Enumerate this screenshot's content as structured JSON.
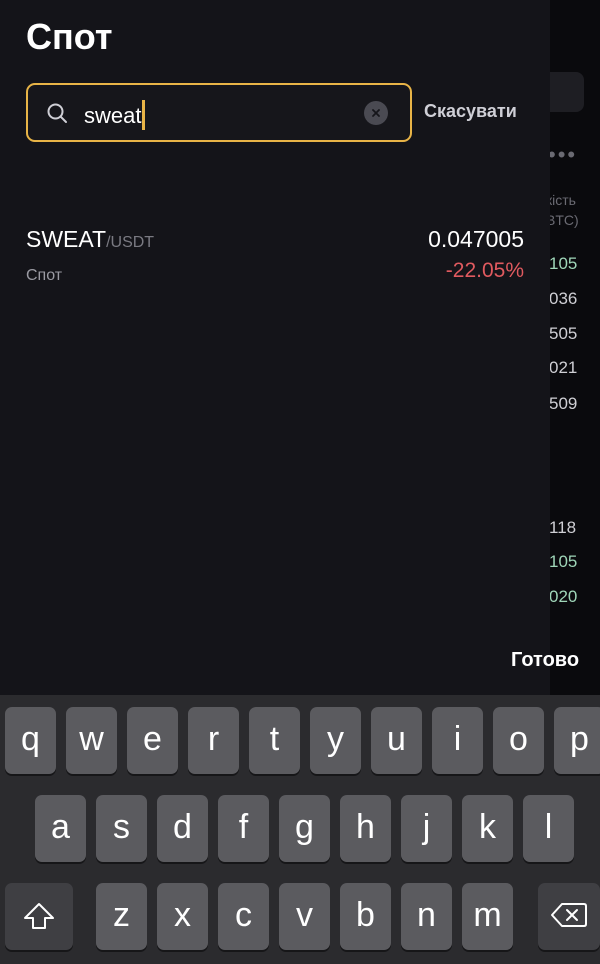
{
  "background": {
    "col_head_1": "кість",
    "col_head_2": "BTC)",
    "values_top": [
      "105",
      "036",
      "505",
      "021",
      "509"
    ],
    "values_bottom": [
      "118",
      "105",
      "020"
    ]
  },
  "panel": {
    "title": "Спот",
    "search": {
      "value": "sweat",
      "cancel_label": "Скасувати"
    },
    "results": [
      {
        "base": "SWEAT",
        "quote": "/USDT",
        "market": "Спот",
        "price": "0.047005",
        "change": "-22.05%"
      }
    ]
  },
  "keyboard": {
    "done_label": "Готово",
    "row1": [
      "q",
      "w",
      "e",
      "r",
      "t",
      "y",
      "u",
      "i",
      "o",
      "p"
    ],
    "row2": [
      "a",
      "s",
      "d",
      "f",
      "g",
      "h",
      "j",
      "k",
      "l"
    ],
    "row3": [
      "z",
      "x",
      "c",
      "v",
      "b",
      "n",
      "m"
    ]
  },
  "colors": {
    "accent": "#e8b447",
    "negative": "#e05a5f",
    "positive": "#9fd6b8"
  }
}
